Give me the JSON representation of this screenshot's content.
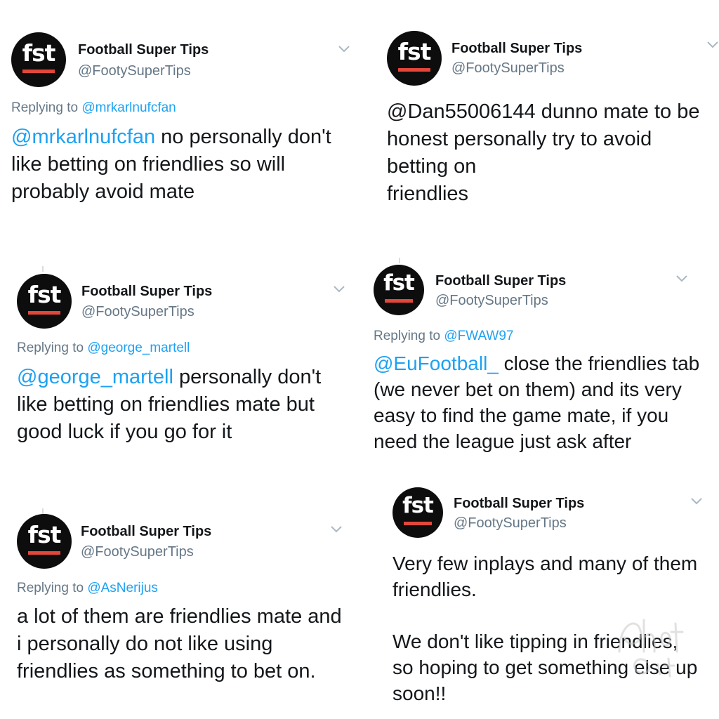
{
  "account": {
    "name": "Football Super Tips",
    "handle": "@FootySuperTips",
    "avatar_text": "fst",
    "colors": {
      "avatar_bg": "#0d0d0d",
      "avatar_bar": "#e2473a",
      "mention": "#1da1f2",
      "secondary": "#657786"
    }
  },
  "tweets": [
    {
      "replying_prefix": "Replying to",
      "replying_to": "@mrkarlnufcfan",
      "mention": "@mrkarlnufcfan",
      "text": " no personally don't like betting on friendlies so will probably avoid mate"
    },
    {
      "text_lines": [
        "@Dan55006144 dunno mate to be honest personally try to avoid betting on",
        "friendlies"
      ]
    },
    {
      "replying_prefix": "Replying to",
      "replying_to": "@george_martell",
      "mention": "@george_martell",
      "text": " personally don't like betting on friendlies mate but good luck if you go for it"
    },
    {
      "replying_prefix": "Replying to",
      "replying_to": "@FWAW97",
      "mention": "@EuFootball_",
      "text": " close the friendlies tab (we never bet on them) and its very easy to find the game mate, if you need the league just ask after"
    },
    {
      "replying_prefix": "Replying to",
      "replying_to": "@AsNerijus",
      "text": "a lot of them are friendlies mate and i personally do not like using friendlies as something to bet on."
    },
    {
      "paragraphs": [
        "Very few inplays and many of them friendlies.",
        "We don't like tipping in friendlies, so hoping to get something else up soon!!"
      ]
    }
  ],
  "icons": {
    "menu": "chevron-down-icon",
    "watermark": "photo-grid-watermark-icon"
  }
}
